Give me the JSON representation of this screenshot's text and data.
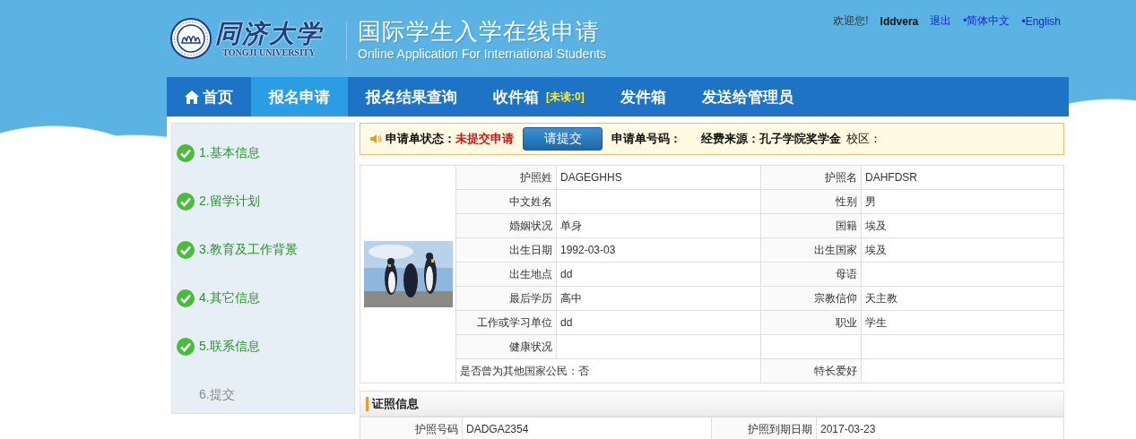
{
  "header": {
    "university_name": "同济大学",
    "university_name_en": "TONGJI UNIVERSITY",
    "title": "国际学生入学在线申请",
    "subtitle": "Online Application For International Students"
  },
  "user_bar": {
    "greeting": "欢迎您!",
    "username": "lddvera",
    "logout": "退出",
    "languages": [
      {
        "label": "•简体中文"
      },
      {
        "label": "•English"
      }
    ]
  },
  "nav": [
    {
      "label": "首页",
      "kind": "home",
      "selected": false
    },
    {
      "label": "报名申请",
      "selected": true,
      "kind": "plain"
    },
    {
      "label": "报名结果查询",
      "selected": false,
      "kind": "plain"
    },
    {
      "label": "收件箱",
      "badge": "[未读:0]",
      "selected": false,
      "kind": "plain"
    },
    {
      "label": "发件箱",
      "selected": false,
      "kind": "plain"
    },
    {
      "label": "发送给管理员",
      "selected": false,
      "kind": "plain"
    }
  ],
  "steps": [
    {
      "label": "1.基本信息",
      "done": true
    },
    {
      "label": "2.留学计划",
      "done": true
    },
    {
      "label": "3.教育及工作背景",
      "done": true
    },
    {
      "label": "4.其它信息",
      "done": true
    },
    {
      "label": "5.联系信息",
      "done": true
    },
    {
      "label": "6.提交",
      "done": false
    }
  ],
  "status": {
    "status_label": "申请单状态：",
    "status_value": "未提交申请",
    "submit_button": "请提交",
    "number_label": "申请单号码：",
    "funding_label": "经费来源：孔子学院奖学金",
    "campus_label": "校区："
  },
  "basic_info": {
    "rows": [
      {
        "left": {
          "label": "护照姓",
          "value": "DAGEGHHS"
        },
        "right": {
          "label": "护照名",
          "value": "DAHFDSR"
        }
      },
      {
        "left": {
          "label": "中文姓名"
        },
        "right": {
          "label": "性别",
          "value": "男"
        }
      },
      {
        "left": {
          "label": "婚姻状况",
          "value": "单身"
        },
        "right": {
          "label": "国籍",
          "value": "埃及"
        }
      },
      {
        "left": {
          "label": "出生日期",
          "value": "1992-03-03"
        },
        "right": {
          "label": "出生国家",
          "value": "埃及"
        }
      },
      {
        "left": {
          "label": "出生地点",
          "value": "dd"
        },
        "right": {
          "label": "母语"
        }
      },
      {
        "left": {
          "label": "最后学历",
          "value": "高中"
        },
        "right": {
          "label": "宗教信仰",
          "value": "天主教"
        }
      },
      {
        "left": {
          "label": "工作或学习单位",
          "value": "dd"
        },
        "right": {
          "label": "职业",
          "value": "学生"
        }
      },
      {
        "left": {
          "label": "健康状况"
        }
      },
      {
        "left": {
          "kind": "statement",
          "text": "是否曾为其他国家公民：否"
        },
        "right": {
          "label": "特长爱好"
        }
      }
    ]
  },
  "certificates": {
    "title": "证照信息",
    "rows": [
      {
        "left": {
          "label": "护照号码",
          "value": "DADGA2354"
        },
        "right": {
          "label": "护照到期日期",
          "value": "2017-03-23"
        }
      }
    ]
  }
}
